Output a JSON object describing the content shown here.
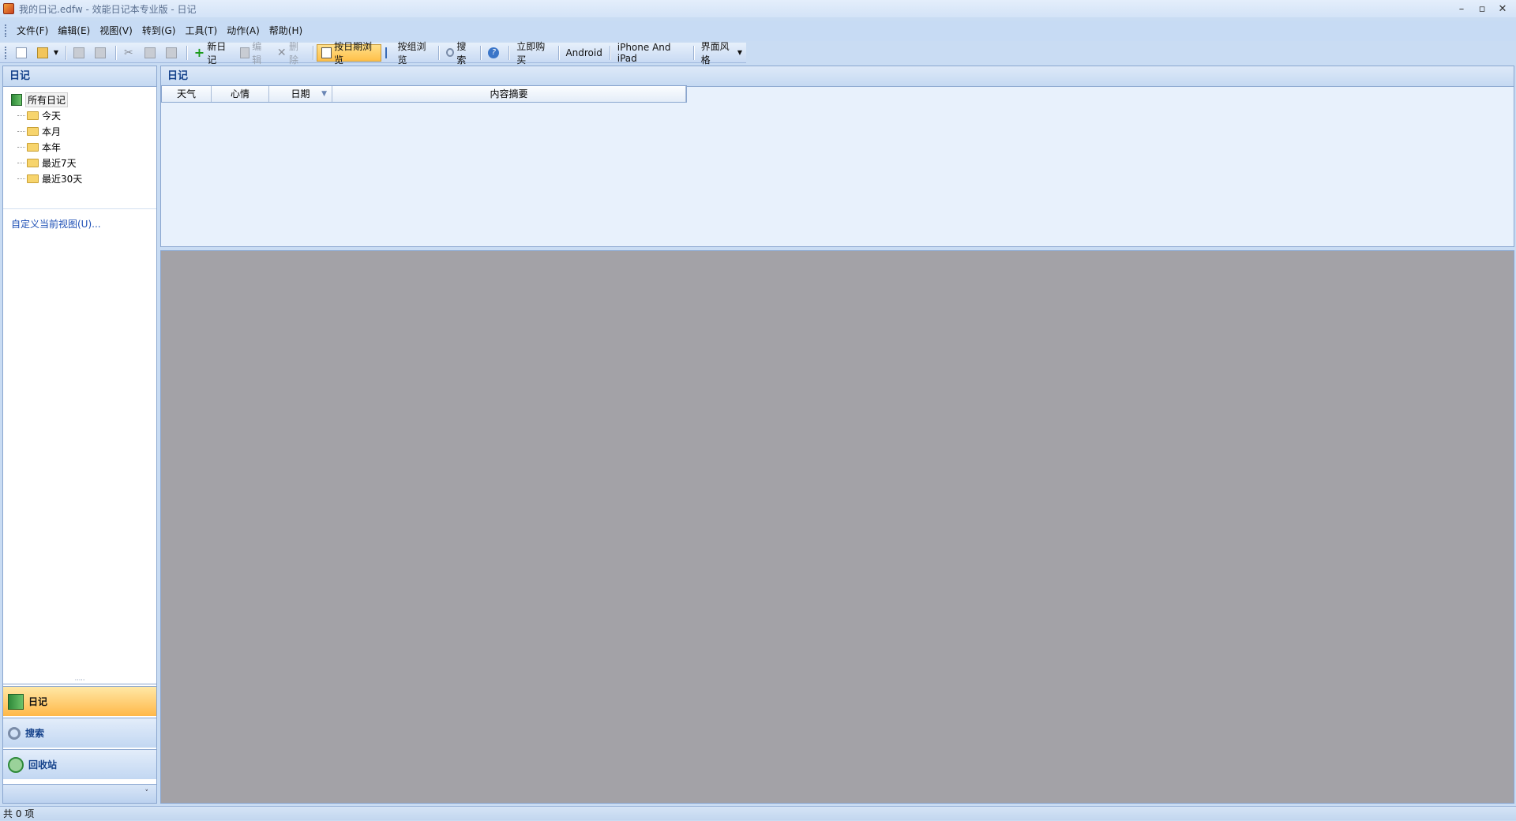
{
  "window": {
    "title": "我的日记.edfw - 效能日记本专业版 - 日记",
    "controls": {
      "minimize": "–",
      "restore": "▫",
      "close": "✕"
    }
  },
  "menu": [
    {
      "label": "文件(F)"
    },
    {
      "label": "编辑(E)"
    },
    {
      "label": "视图(V)"
    },
    {
      "label": "转到(G)"
    },
    {
      "label": "工具(T)"
    },
    {
      "label": "动作(A)"
    },
    {
      "label": "帮助(H)"
    }
  ],
  "toolbar": {
    "new_diary": "新日记",
    "edit": "编辑",
    "delete": "删除",
    "browse_by_date": "按日期浏览",
    "browse_by_group": "按组浏览",
    "search": "搜索",
    "buy_now": "立即购买",
    "android": "Android",
    "iphone_ipad": "iPhone And iPad",
    "ui_style": "界面风格"
  },
  "left_pane": {
    "header": "日记",
    "tree_root": "所有日记",
    "tree_items": [
      "今天",
      "本月",
      "本年",
      "最近7天",
      "最近30天"
    ],
    "custom_view": "自定义当前视图(U)...",
    "nav_buttons": [
      {
        "label": "日记",
        "active": true
      },
      {
        "label": "搜索",
        "active": false
      },
      {
        "label": "回收站",
        "active": false
      }
    ],
    "footer_arrow": "˅"
  },
  "list_pane": {
    "header": "日记",
    "columns": [
      "天气",
      "心情",
      "日期",
      "内容摘要"
    ]
  },
  "statusbar": {
    "text": "共 0 项"
  }
}
